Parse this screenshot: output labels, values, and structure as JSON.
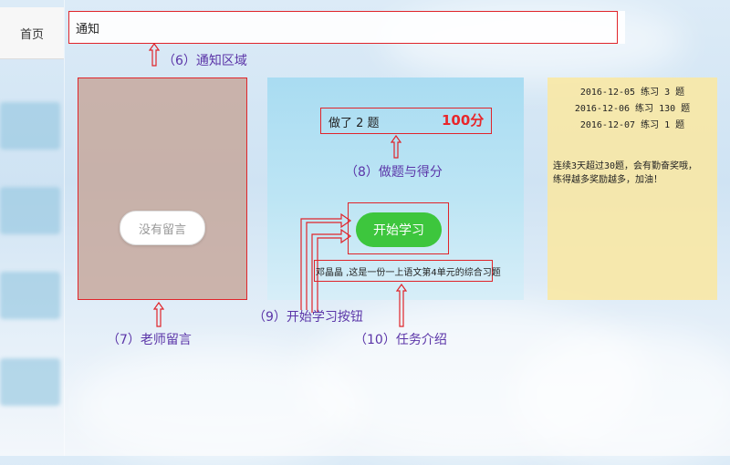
{
  "nav": {
    "home_label": "首页"
  },
  "notice": {
    "label": "通知",
    "caption": "（6）通知区域"
  },
  "teacher": {
    "no_message_label": "没有留言",
    "caption": "（7）老师留言"
  },
  "score": {
    "done_text": "做了 2 题",
    "score_text": "100分",
    "caption": "（8）做题与得分"
  },
  "start": {
    "button_label": "开始学习",
    "caption": "（9）开始学习按钮"
  },
  "task": {
    "text": "邓晶晶 ,这是一份一上语文第4单元的综合习题",
    "caption": "（10）任务介绍"
  },
  "records": [
    "2016-12-05 练习 3 题",
    "2016-12-06 练习 130 题",
    "2016-12-07 练习 1 题"
  ],
  "reward": {
    "line1": "连续3天超过30题，会有勤奋奖哦，",
    "line2": "练得越多奖励越多，加油！"
  },
  "colors": {
    "annotation_red": "#e0242a",
    "caption_purple": "#5b35a8",
    "start_green": "#3dc63d",
    "score_red": "#e8262a"
  }
}
